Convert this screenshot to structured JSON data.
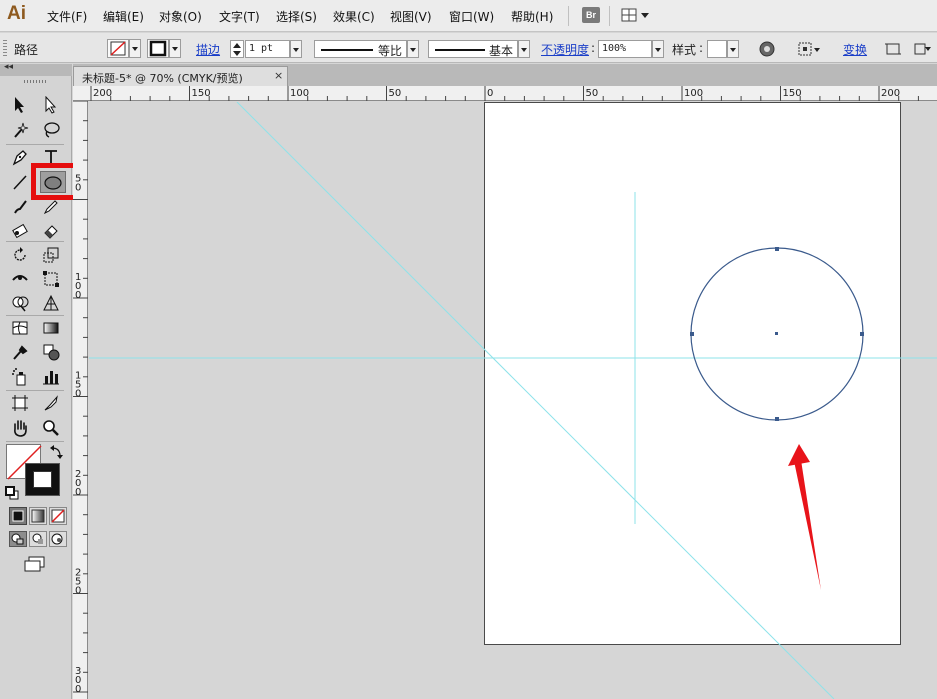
{
  "app": {
    "logo": "Ai",
    "menu": [
      "文件(F)",
      "编辑(E)",
      "对象(O)",
      "文字(T)",
      "选择(S)",
      "效果(C)",
      "视图(V)",
      "窗口(W)",
      "帮助(H)"
    ],
    "bridge_label": "Br"
  },
  "control_bar": {
    "selection_label": "路径",
    "stroke_link": "描边",
    "stroke_weight": "1 pt",
    "profile_label": "等比",
    "brush_label": "基本",
    "opacity_link": "不透明度",
    "opacity_value": "100%",
    "style_label": "样式",
    "transform_link": "变换"
  },
  "document": {
    "tab_title": "未标题-5* @ 70% (CMYK/预览)",
    "close_glyph": "×"
  },
  "rulers": {
    "horizontal_labels": [
      "200",
      "150",
      "100",
      "50",
      "0",
      "50",
      "100",
      "150",
      "200"
    ],
    "vertical_labels": [
      "50",
      "100",
      "150",
      "200",
      "250",
      "300"
    ]
  },
  "toolbar": {
    "collapse_glyph": "◂◂",
    "highlighted_tool": "ellipse-tool"
  },
  "colors": {
    "highlight": "#e50d0d",
    "guide": "#8ee3ea",
    "path": "#3a5a8c",
    "arrow": "#e8141a",
    "link": "#1a3ec8"
  }
}
